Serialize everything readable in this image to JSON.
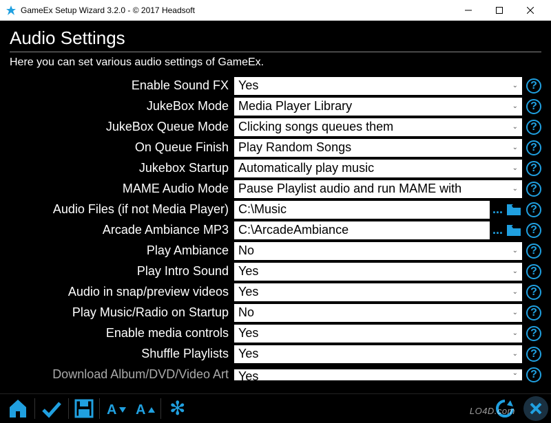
{
  "window": {
    "title": "GameEx Setup Wizard 3.2.0 - © 2017 Headsoft"
  },
  "page": {
    "heading": "Audio Settings",
    "subtext": "Here you can set various audio settings of GameEx."
  },
  "settings": [
    {
      "label": "Enable Sound FX",
      "type": "dropdown",
      "value": "Yes"
    },
    {
      "label": "JukeBox Mode",
      "type": "dropdown",
      "value": "Media Player Library"
    },
    {
      "label": "JukeBox Queue Mode",
      "type": "dropdown",
      "value": "Clicking songs queues them"
    },
    {
      "label": "On Queue Finish",
      "type": "dropdown",
      "value": "Play Random Songs"
    },
    {
      "label": "Jukebox Startup",
      "type": "dropdown",
      "value": "Automatically play music"
    },
    {
      "label": "MAME Audio Mode",
      "type": "dropdown",
      "value": "Pause Playlist audio and run MAME with"
    },
    {
      "label": "Audio Files (if not Media Player)",
      "type": "path",
      "value": "C:\\Music"
    },
    {
      "label": "Arcade Ambiance MP3",
      "type": "path",
      "value": "C:\\ArcadeAmbiance"
    },
    {
      "label": "Play Ambiance",
      "type": "dropdown",
      "value": "No"
    },
    {
      "label": "Play Intro Sound",
      "type": "dropdown",
      "value": "Yes"
    },
    {
      "label": "Audio in snap/preview videos",
      "type": "dropdown",
      "value": "Yes"
    },
    {
      "label": "Play Music/Radio on Startup",
      "type": "dropdown",
      "value": "No"
    },
    {
      "label": "Enable media controls",
      "type": "dropdown",
      "value": "Yes"
    },
    {
      "label": "Shuffle Playlists",
      "type": "dropdown",
      "value": "Yes"
    },
    {
      "label": "Download Album/DVD/Video Art",
      "type": "dropdown",
      "value": "Yes"
    }
  ],
  "watermark": "LO4D.com"
}
